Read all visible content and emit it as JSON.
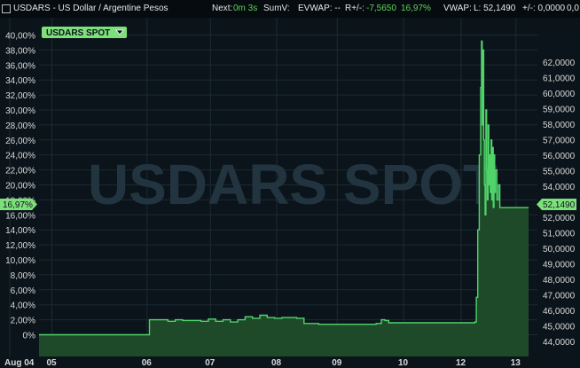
{
  "header": {
    "icon": "square-checkbox-icon",
    "title": "USDARS - US Dollar / Argentine Pesos",
    "next_label": "Next:",
    "next_value": "0m 3s",
    "sumv_label": "SumV:",
    "evwap_label": "EVWAP: --",
    "rpm_label": "R+/-:",
    "rpm_value": "-7,5650",
    "rpm_pct": "16,97%",
    "vwap_label": "VWAP:",
    "last_label": "L: 52,1490",
    "change_label": "+/-: 0,0000",
    "extra": "0,0"
  },
  "legend": {
    "label": "USDARS SPOT",
    "icon": "triangle-down-icon"
  },
  "watermark": "USDARS SPOT",
  "badges": {
    "left_value": "16,97%",
    "right_value": "52,1490"
  },
  "colors": {
    "line": "#4fd36a",
    "fill": "#1f4a2a",
    "bg": "#0b141a",
    "grid": "#1b2a33",
    "badge": "#7ee07a"
  },
  "chart_data": {
    "type": "area",
    "title": "",
    "xlabel": "",
    "ylabel": "",
    "x_tick_labels": [
      "Aug 04",
      "05",
      "06",
      "07",
      "08",
      "09",
      "10",
      "12",
      "13"
    ],
    "y_left_ticks": [
      "0%",
      "2,00%",
      "4,00%",
      "6,00%",
      "8,00%",
      "10,00%",
      "12,00%",
      "14,00%",
      "16,00%",
      "18,00%",
      "20,00%",
      "22,00%",
      "24,00%",
      "26,00%",
      "28,00%",
      "30,00%",
      "32,00%",
      "34,00%",
      "36,00%",
      "38,00%",
      "40,00%"
    ],
    "y_right_ticks": [
      "44,0000",
      "45,0000",
      "46,0000",
      "47,0000",
      "48,0000",
      "49,0000",
      "50,0000",
      "51,0000",
      "52,0000",
      "53,0000",
      "54,0000",
      "55,0000",
      "56,0000",
      "57,0000",
      "58,0000",
      "59,0000",
      "60,0000",
      "61,0000",
      "62,0000"
    ],
    "ylim_pct": [
      -1.0,
      41.0
    ],
    "grid": true,
    "series": [
      {
        "unit": "percent change",
        "points": [
          [
            0,
            0
          ],
          [
            14.8,
            0
          ],
          [
            15,
            2.0
          ],
          [
            16,
            2.0
          ],
          [
            17.5,
            1.8
          ],
          [
            18.5,
            2.0
          ],
          [
            19.5,
            1.9
          ],
          [
            20,
            1.9
          ],
          [
            21,
            1.9
          ],
          [
            22,
            1.8
          ],
          [
            23,
            2.1
          ],
          [
            24,
            1.8
          ],
          [
            25,
            2.0
          ],
          [
            26,
            1.7
          ],
          [
            27,
            2.0
          ],
          [
            28,
            2.4
          ],
          [
            29,
            2.2
          ],
          [
            30,
            2.6
          ],
          [
            31,
            2.3
          ],
          [
            32,
            2.2
          ],
          [
            33,
            2.3
          ],
          [
            34,
            2.3
          ],
          [
            35,
            2.2
          ],
          [
            36,
            1.5
          ],
          [
            38,
            1.4
          ],
          [
            40,
            1.4
          ],
          [
            42,
            1.4
          ],
          [
            44,
            1.4
          ],
          [
            45.8,
            1.5
          ],
          [
            46.5,
            2.0
          ],
          [
            47,
            1.9
          ],
          [
            47.5,
            1.6
          ],
          [
            48,
            1.6
          ],
          [
            49,
            1.6
          ],
          [
            50,
            1.6
          ],
          [
            52,
            1.6
          ],
          [
            54,
            1.6
          ],
          [
            56,
            1.6
          ],
          [
            58,
            1.6
          ],
          [
            59.2,
            1.7
          ],
          [
            59.4,
            5.0
          ],
          [
            59.6,
            14.0
          ],
          [
            59.8,
            24.0
          ],
          [
            60.0,
            33.0
          ],
          [
            60.1,
            39.2
          ],
          [
            60.2,
            28.0
          ],
          [
            60.3,
            38.0
          ],
          [
            60.4,
            26.0
          ],
          [
            60.5,
            20.0
          ],
          [
            60.6,
            16.0
          ],
          [
            60.7,
            30.0
          ],
          [
            60.8,
            22.0
          ],
          [
            60.9,
            18.0
          ],
          [
            61.0,
            28.0
          ],
          [
            61.1,
            20.0
          ],
          [
            61.2,
            24.0
          ],
          [
            61.3,
            19.0
          ],
          [
            61.4,
            26.0
          ],
          [
            61.5,
            18.0
          ],
          [
            61.6,
            25.0
          ],
          [
            61.7,
            17.0
          ],
          [
            61.8,
            24.0
          ],
          [
            61.9,
            19.0
          ],
          [
            62.0,
            22.0
          ],
          [
            62.2,
            18.0
          ],
          [
            62.4,
            20.0
          ],
          [
            62.6,
            16.97
          ],
          [
            64,
            16.97
          ],
          [
            66,
            16.97
          ],
          [
            66.5,
            16.97
          ]
        ]
      }
    ]
  }
}
